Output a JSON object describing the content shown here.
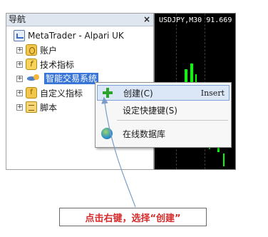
{
  "navigator": {
    "title": "导航",
    "close": "×",
    "root": "MetaTrader - Alpari UK",
    "items": [
      {
        "label": "账户"
      },
      {
        "label": "技术指标"
      },
      {
        "label": "智能交易系统"
      },
      {
        "label": "自定义指标"
      },
      {
        "label": "脚本"
      }
    ],
    "expander": "+"
  },
  "chart": {
    "title": "USDJPY,M30  91.669"
  },
  "context_menu": {
    "items": [
      {
        "label": "创建(C)",
        "shortcut": "Insert",
        "icon": "plus-icon"
      },
      {
        "label": "设定快捷键(S)",
        "shortcut": "",
        "icon": ""
      },
      {
        "label": "在线数据库",
        "shortcut": "",
        "icon": "globe-icon"
      }
    ]
  },
  "callout": {
    "text": "点击右键，选择“创建”"
  },
  "colors": {
    "selection": "#3875d7",
    "callout_text": "#d62b2b",
    "candle": "#00ff00"
  }
}
